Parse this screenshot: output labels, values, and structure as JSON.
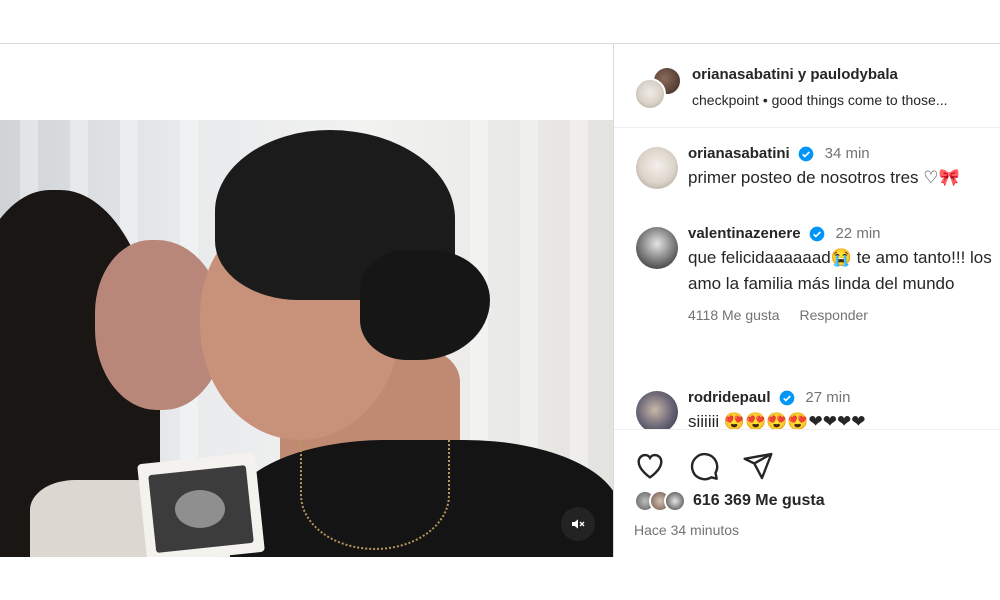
{
  "post": {
    "header": {
      "names": "orianasabatini y paulodybala",
      "audio": "checkpoint • good things come to those..."
    },
    "comments": [
      {
        "username": "orianasabatini",
        "time": "34 min",
        "text": "primer posteo de nosotros tres ♡🎀",
        "verified": true
      },
      {
        "username": "valentinazenere",
        "time": "22 min",
        "text": "que felicidaaaaaad😭 te amo tanto!!! los amo la familia más linda del mundo",
        "likes": "4118 Me gusta",
        "reply": "Responder",
        "verified": true
      },
      {
        "username": "rodridepaul",
        "time": "27 min",
        "text": "siiiiii 😍😍😍😍❤❤❤❤",
        "verified": true
      }
    ],
    "likes_count": "616 369 Me gusta",
    "posted_ago": "Hace 34 minutos"
  },
  "icons": {
    "like": "heart-icon",
    "comment": "comment-icon",
    "share": "share-icon",
    "mute": "speaker-muted-icon",
    "verified": "verified-badge-icon"
  },
  "colors": {
    "verified": "#0095f6",
    "text": "#262626",
    "secondary": "#737373",
    "border": "#dbdbdb"
  }
}
